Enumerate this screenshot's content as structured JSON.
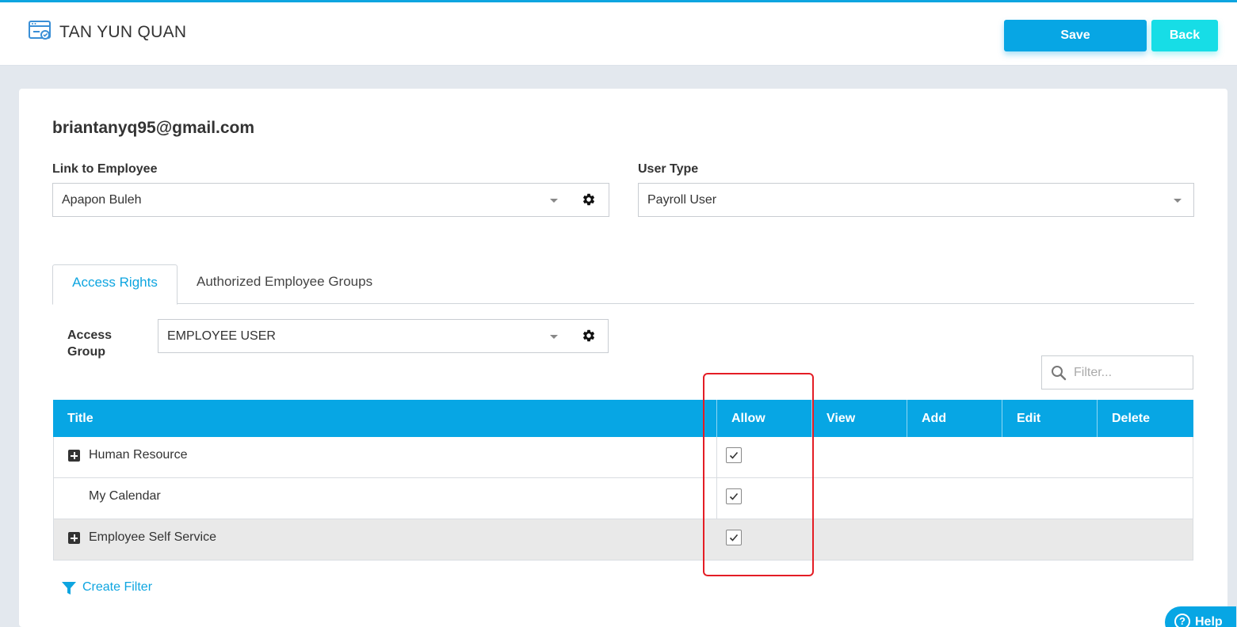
{
  "header": {
    "title": "TAN YUN QUAN",
    "save_label": "Save",
    "back_label": "Back"
  },
  "account": {
    "email": "briantanyq95@gmail.com"
  },
  "link_to_employee": {
    "label": "Link to Employee",
    "value": "Apapon Buleh"
  },
  "user_type": {
    "label": "User Type",
    "value": "Payroll User"
  },
  "tabs": [
    {
      "label": "Access Rights",
      "active": true
    },
    {
      "label": "Authorized Employee Groups",
      "active": false
    }
  ],
  "access_group": {
    "label": "Access Group",
    "value": "EMPLOYEE USER"
  },
  "filter": {
    "placeholder": "Filter..."
  },
  "grid": {
    "columns": [
      "Title",
      "Allow",
      "View",
      "Add",
      "Edit",
      "Delete"
    ],
    "rows": [
      {
        "title": "Human Resource",
        "expandable": true,
        "allow": true
      },
      {
        "title": "My Calendar",
        "expandable": false,
        "allow": true
      },
      {
        "title": "Employee Self Service",
        "expandable": true,
        "allow": true
      }
    ]
  },
  "create_filter_label": "Create Filter",
  "help_label": "Help",
  "colors": {
    "accent": "#07a6e4",
    "back_button": "#17dde6",
    "highlight": "#e41d25"
  }
}
